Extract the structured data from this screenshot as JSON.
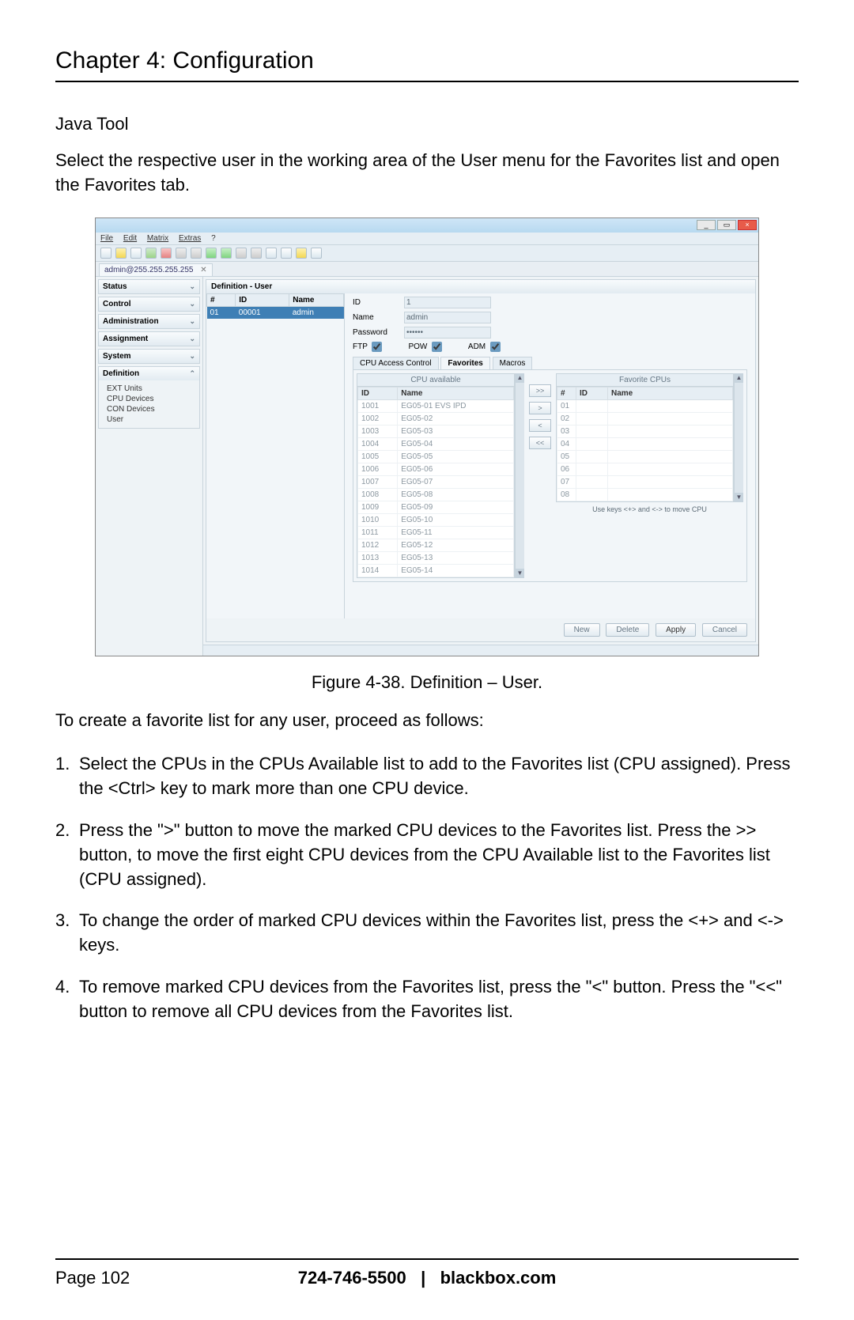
{
  "chapter": "Chapter 4: Configuration",
  "section": "Java Tool",
  "intro": "Select the respective user in the working area of the User menu for the Favorites list and open the Favorites tab.",
  "figure_caption": "Figure 4-38. Definition – User.",
  "lead": "To create a favorite list for any user, proceed as follows:",
  "steps": {
    "s1": "Select the CPUs in the CPUs Available list to add to the Favorites list (CPU assigned). Press the <Ctrl> key to mark more than one CPU device.",
    "s2": "Press the \">\" button to move the marked CPU devices to the Favorites list. Press the >> button, to move the first eight CPU devices from the CPU Available list to the Favorites list (CPU assigned).",
    "s3": "To change the order of marked CPU devices within the Favorites list, press the <+> and <-> keys.",
    "s4": "To remove marked CPU devices from the Favorites list, press the \"<\" button. Press the \"<<\" button to remove all CPU devices from the Favorites list."
  },
  "footer": {
    "page": "Page 102",
    "phone": "724-746-5500",
    "sep": "|",
    "site": "blackbox.com"
  },
  "app": {
    "menus": {
      "file": "File",
      "edit": "Edit",
      "matrix": "Matrix",
      "extras": "Extras",
      "help": "?"
    },
    "conn_tab": "admin@255.255.255.255",
    "nav": {
      "status": "Status",
      "control": "Control",
      "admin": "Administration",
      "assign": "Assignment",
      "system": "System",
      "def": "Definition",
      "ext": "EXT Units",
      "cpu": "CPU Devices",
      "con": "CON Devices",
      "user": "User"
    },
    "def_title": "Definition - User",
    "user_cols": {
      "num": "#",
      "id": "ID",
      "name": "Name"
    },
    "user_row": {
      "num": "01",
      "id": "00001",
      "name": "admin"
    },
    "form": {
      "id_label": "ID",
      "id_value": "1",
      "name_label": "Name",
      "name_value": "admin",
      "pwd_label": "Password",
      "pwd_value": "••••••",
      "ftp": "FTP",
      "pow": "POW",
      "adm": "ADM"
    },
    "tabs": {
      "cpu": "CPU Access Control",
      "fav": "Favorites",
      "mac": "Macros"
    },
    "avail_head": "CPU available",
    "fav_head": "Favorite CPUs",
    "cols": {
      "id": "ID",
      "name": "Name",
      "num": "#"
    },
    "avail": [
      {
        "id": "1001",
        "name": "EG05-01 EVS IPD"
      },
      {
        "id": "1002",
        "name": "EG05-02"
      },
      {
        "id": "1003",
        "name": "EG05-03"
      },
      {
        "id": "1004",
        "name": "EG05-04"
      },
      {
        "id": "1005",
        "name": "EG05-05"
      },
      {
        "id": "1006",
        "name": "EG05-06"
      },
      {
        "id": "1007",
        "name": "EG05-07"
      },
      {
        "id": "1008",
        "name": "EG05-08"
      },
      {
        "id": "1009",
        "name": "EG05-09"
      },
      {
        "id": "1010",
        "name": "EG05-10"
      },
      {
        "id": "1011",
        "name": "EG05-11"
      },
      {
        "id": "1012",
        "name": "EG05-12"
      },
      {
        "id": "1013",
        "name": "EG05-13"
      },
      {
        "id": "1014",
        "name": "EG05-14"
      }
    ],
    "fav_rows": [
      "01",
      "02",
      "03",
      "04",
      "05",
      "06",
      "07",
      "08"
    ],
    "move": {
      "addall": ">>",
      "add": ">",
      "rem": "<",
      "remall": "<<"
    },
    "hint": "Use keys <+> and <-> to move CPU",
    "actions": {
      "new": "New",
      "delete": "Delete",
      "apply": "Apply",
      "cancel": "Cancel"
    }
  }
}
